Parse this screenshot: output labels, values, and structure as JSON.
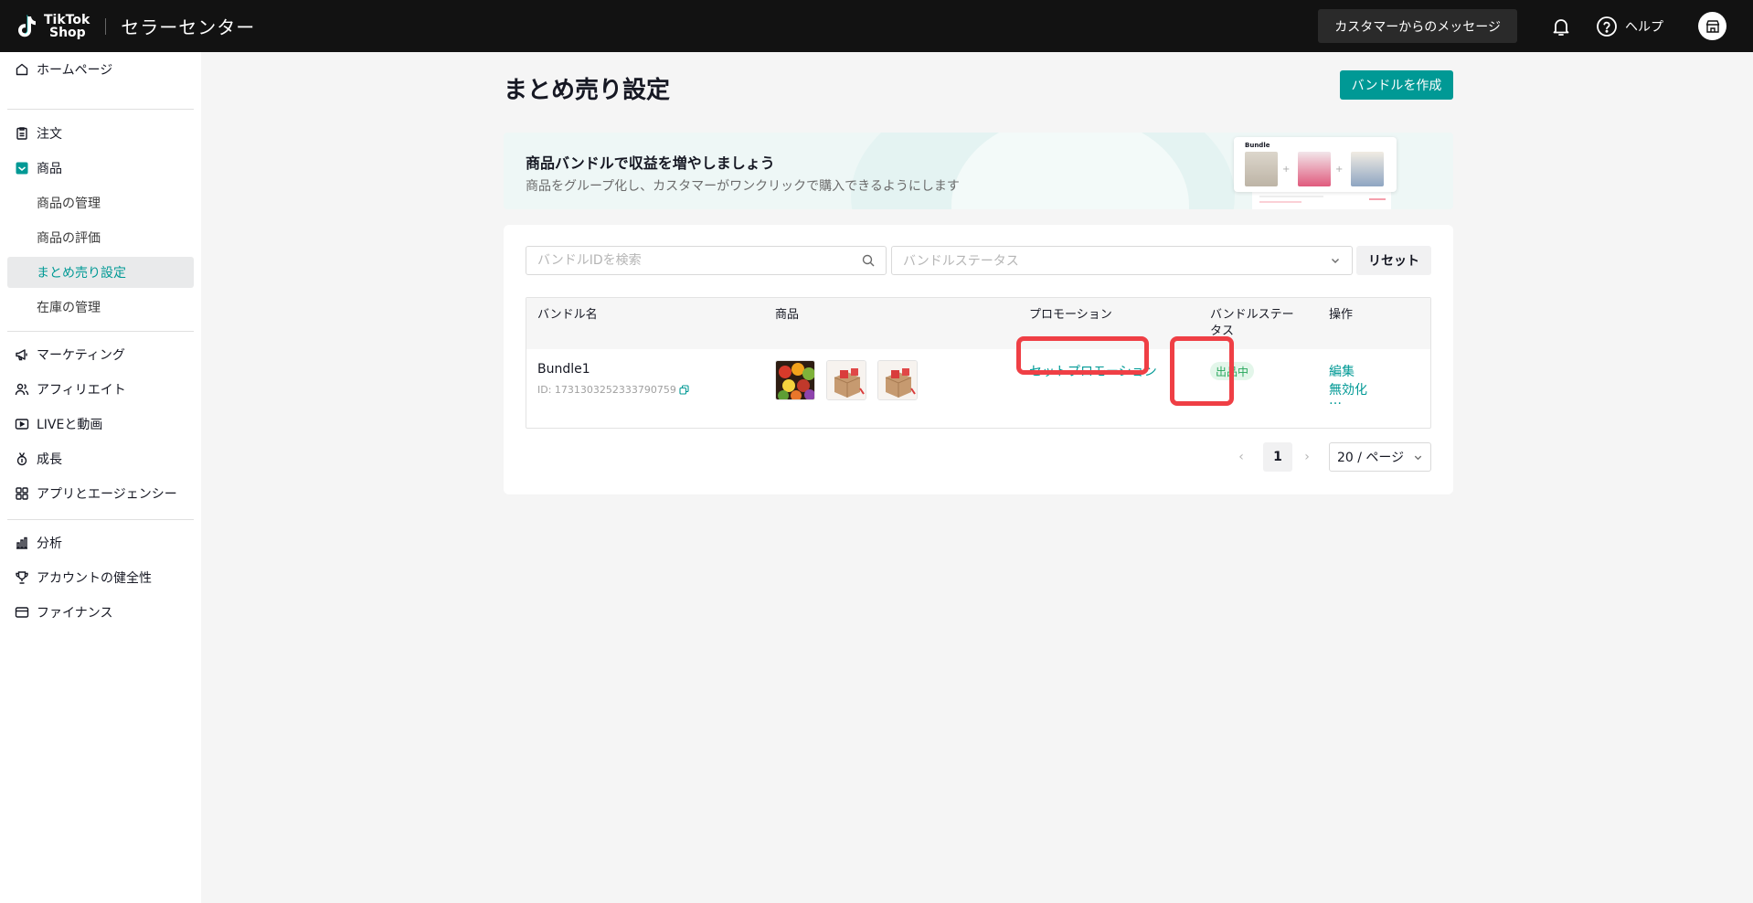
{
  "header": {
    "brand_line1": "TikTok",
    "brand_line2": "Shop",
    "title": "セラーセンター",
    "messages_button": "カスタマーからのメッセージ",
    "help_label": "ヘルプ"
  },
  "sidebar": {
    "items": [
      {
        "label": "ホームページ",
        "icon": "home-icon"
      },
      {
        "label": "注文",
        "icon": "clipboard-icon"
      },
      {
        "label": "商品",
        "icon": "product-icon"
      },
      {
        "label": "商品の管理"
      },
      {
        "label": "商品の評価"
      },
      {
        "label": "まとめ売り設定",
        "active": true
      },
      {
        "label": "在庫の管理"
      },
      {
        "label": "マーケティング",
        "icon": "megaphone-icon"
      },
      {
        "label": "アフィリエイト",
        "icon": "users-icon"
      },
      {
        "label": "LIVEと動画",
        "icon": "video-icon"
      },
      {
        "label": "成長",
        "icon": "medal-icon"
      },
      {
        "label": "アプリとエージェンシー",
        "icon": "apps-icon"
      },
      {
        "label": "分析",
        "icon": "chart-icon"
      },
      {
        "label": "アカウントの健全性",
        "icon": "trophy-icon"
      },
      {
        "label": "ファイナンス",
        "icon": "wallet-icon"
      }
    ]
  },
  "main": {
    "title": "まとめ売り設定",
    "create_button": "バンドルを作成",
    "banner": {
      "title": "商品バンドルで収益を増やしましょう",
      "subtitle": "商品をグループ化し、カスタマーがワンクリックで購入できるようにします",
      "card_title": "Bundle"
    },
    "filters": {
      "search_placeholder": "バンドルIDを検索",
      "status_placeholder": "バンドルステータス",
      "reset": "リセット"
    },
    "table": {
      "headers": [
        "バンドル名",
        "商品",
        "プロモーション",
        "バンドルステータス",
        "操作"
      ],
      "rows": [
        {
          "name": "Bundle1",
          "id": "ID: 1731303252333790759",
          "promotion": "セットプロモーション",
          "status": "出品中",
          "actions": [
            "編集",
            "無効化",
            "…"
          ]
        }
      ]
    },
    "pagination": {
      "current_page": "1",
      "page_size": "20 / ページ"
    }
  },
  "colors": {
    "accent": "#009995",
    "topbar": "#121212",
    "highlight": "#ef3f45",
    "status_green": "#26a65b"
  }
}
